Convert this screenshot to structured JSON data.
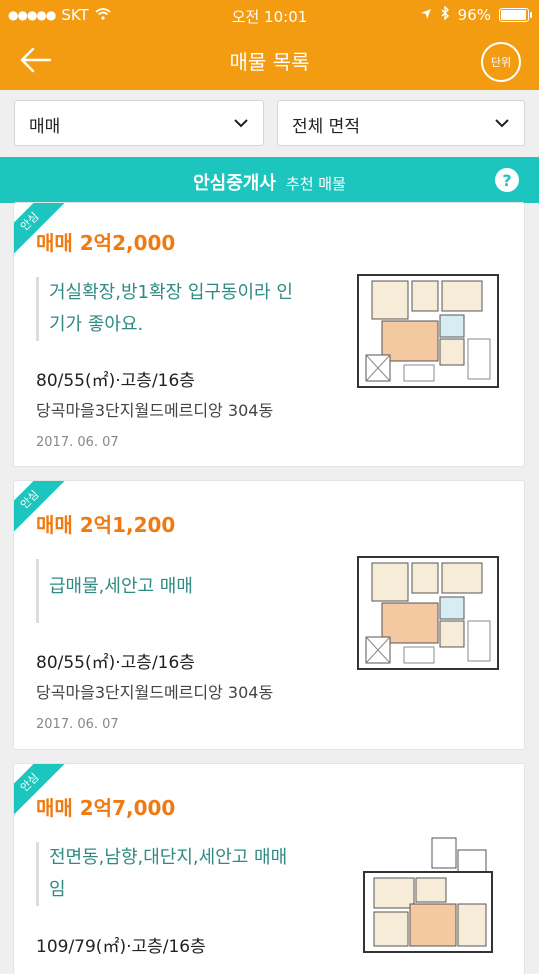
{
  "status": {
    "carrier": "SKT",
    "time": "오전 10:01",
    "battery": "96%"
  },
  "nav": {
    "title": "매물 목록",
    "unit_label": "단위"
  },
  "filters": {
    "deal_type": "매매",
    "area": "전체 면적"
  },
  "banner": {
    "brand": "안심중개사",
    "label": "추천 매물",
    "help": "?"
  },
  "listings": [
    {
      "badge": "안심",
      "price": "매매 2억2,000",
      "desc_line1": "거실확장,방1확장 입구동이라 인",
      "desc_line2": "기가 좋아요.",
      "spec": "80/55(㎡)·고층/16층",
      "apartment": "당곡마을3단지월드메르디앙 304동",
      "date": "2017. 06. 07"
    },
    {
      "badge": "안심",
      "price": "매매 2억1,200",
      "desc_line1": "급매물,세안고 매매",
      "desc_line2": "",
      "spec": "80/55(㎡)·고층/16층",
      "apartment": "당곡마을3단지월드메르디앙 304동",
      "date": "2017. 06. 07"
    },
    {
      "badge": "안심",
      "price": "매매 2억7,000",
      "desc_line1": "전면동,남향,대단지,세안고 매매",
      "desc_line2": "임",
      "spec": "109/79(㎡)·고층/16층",
      "apartment": "",
      "date": ""
    }
  ],
  "colors": {
    "primary": "#f39c12",
    "accent": "#1cc5bd",
    "price": "#f07a12",
    "desc": "#2e8b83"
  }
}
